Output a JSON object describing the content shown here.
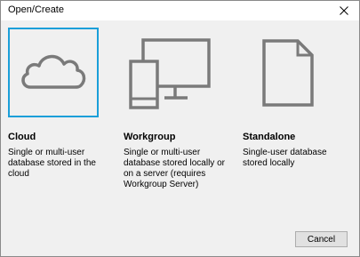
{
  "window": {
    "title": "Open/Create"
  },
  "options": [
    {
      "name": "Cloud",
      "description": "Single or multi-user database stored in the cloud",
      "icon": "cloud-icon"
    },
    {
      "name": "Workgroup",
      "description": "Single or multi-user database stored locally or on a server (requires Workgroup Server)",
      "icon": "workgroup-icon"
    },
    {
      "name": "Standalone",
      "description": "Single-user database stored locally",
      "icon": "document-icon"
    }
  ],
  "buttons": {
    "cancel": "Cancel"
  },
  "colors": {
    "selection_border": "#1a9fd9",
    "icon_gray": "#7a7a7a"
  }
}
